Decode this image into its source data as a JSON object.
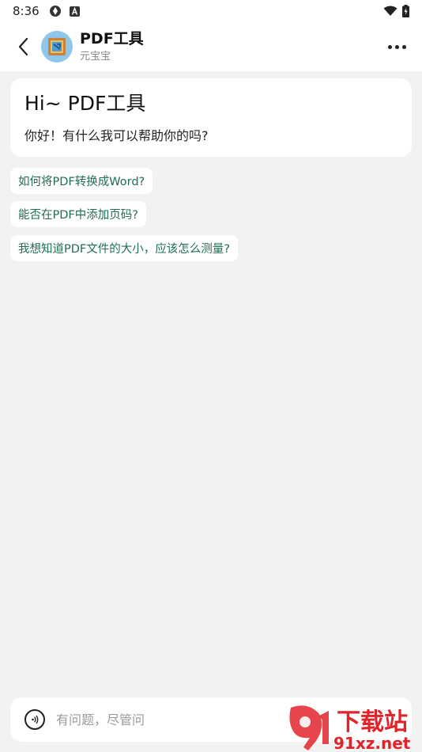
{
  "status_bar": {
    "time": "8:36"
  },
  "header": {
    "title": "PDF工具",
    "subtitle": "元宝宝",
    "back_icon": "chevron-left-icon",
    "more_icon": "more-horizontal-icon"
  },
  "greeting": {
    "title": "Hi~ PDF工具",
    "text": "你好！有什么我可以帮助你的吗?"
  },
  "suggestions": [
    {
      "label": "如何将PDF转换成Word?"
    },
    {
      "label": "能否在PDF中添加页码?"
    },
    {
      "label": "我想知道PDF文件的大小，应该怎么测量?"
    }
  ],
  "input": {
    "placeholder": "有问题，尽管问",
    "voice_icon": "voice-icon"
  },
  "watermark": {
    "logo_text": "下载站",
    "site": "91xz.net"
  },
  "colors": {
    "background": "#f2f2f2",
    "card": "#ffffff",
    "suggestion_text": "#1f6f4f",
    "watermark_red": "#e0242b"
  }
}
